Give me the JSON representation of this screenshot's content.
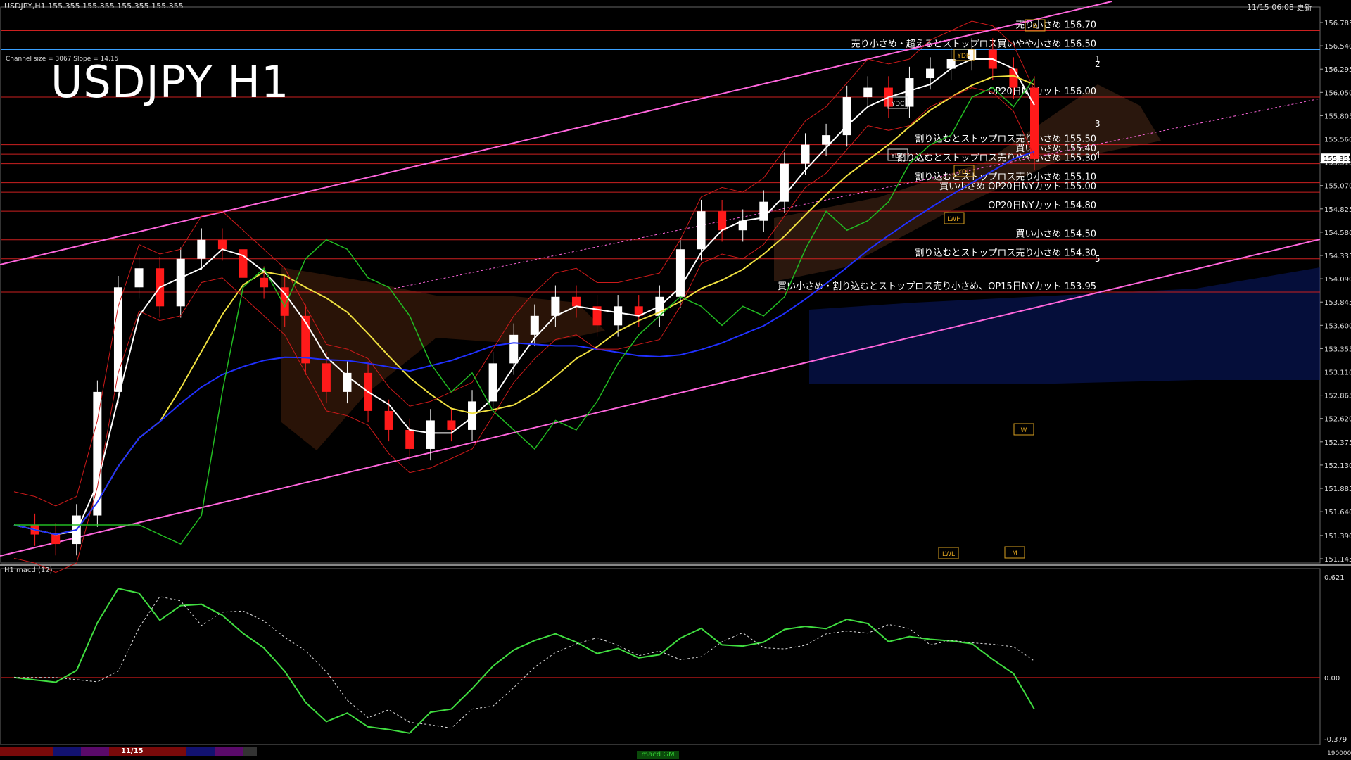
{
  "header": {
    "symbol_line": "USDJPY,H1  155.355 155.355 155.355 155.355",
    "datetime": "11/15 06:08 更新",
    "channel_info": "Channel size = 3067 Slope = 14.15",
    "title": "USDJPY H1",
    "macd_label": "H1  macd (12)"
  },
  "chart_data": {
    "type": "line",
    "title": "USDJPY H1",
    "price_axis": {
      "ticks": [
        "156.785",
        "156.540",
        "156.295",
        "156.050",
        "155.805",
        "155.560",
        "155.315",
        "155.070",
        "154.825",
        "154.580",
        "154.335",
        "154.090",
        "153.845",
        "153.600",
        "153.355",
        "153.110",
        "152.865",
        "152.620",
        "152.375",
        "152.130",
        "151.885",
        "151.640",
        "151.390",
        "151.145"
      ],
      "range": [
        151.145,
        156.785
      ],
      "current_price": "155.355"
    },
    "levels": [
      {
        "price": 156.7,
        "label": "売り小さめ 156.70",
        "color": "#cc2020"
      },
      {
        "price": 156.5,
        "label": "売り小さめ・超えるとストップロス買いやや小さめ 156.50",
        "color": "#3aa0ff"
      },
      {
        "price": 156.0,
        "label": "OP20日NYカット 156.00",
        "color": "#cc2020"
      },
      {
        "price": 155.5,
        "label": "割り込むとストップロス売り小さめ 155.50",
        "color": "#cc2020"
      },
      {
        "price": 155.4,
        "label": "買い小さめ 155.40",
        "color": "#cc2020"
      },
      {
        "price": 155.3,
        "label": "割り込むとストップロス売りやや小さめ 155.30",
        "color": "#cc2020"
      },
      {
        "price": 155.1,
        "label": "割り込むとストップロス売り小さめ 155.10",
        "color": "#cc2020"
      },
      {
        "price": 155.0,
        "label": "買い小さめ OP20日NYカット 155.00",
        "color": "#cc2020"
      },
      {
        "price": 154.8,
        "label": "OP20日NYカット 154.80",
        "color": "#cc2020"
      },
      {
        "price": 154.5,
        "label": "買い小さめ 154.50",
        "color": "#cc2020"
      },
      {
        "price": 154.3,
        "label": "割り込むとストップロス売り小さめ 154.30",
        "color": "#cc2020"
      },
      {
        "price": 153.95,
        "label": "買い小さめ・割り込むとストップロス売り小さめ、OP15日NYカット 153.95",
        "color": "#cc2020"
      }
    ],
    "scenario_labels": [
      "1",
      "2",
      "3",
      "4",
      "5"
    ],
    "markers": [
      "YDC",
      "YDH",
      "YDO",
      "YDL",
      "LWL",
      "LWH",
      "W",
      "D",
      "M"
    ],
    "close_prices": [
      151.5,
      151.4,
      151.3,
      151.6,
      152.9,
      154.0,
      154.2,
      153.8,
      154.3,
      154.5,
      154.4,
      154.1,
      154.0,
      153.7,
      153.2,
      152.9,
      153.1,
      152.7,
      152.5,
      152.3,
      152.6,
      152.5,
      152.8,
      153.2,
      153.5,
      153.7,
      153.9,
      153.8,
      153.6,
      153.8,
      153.7,
      153.9,
      154.4,
      154.8,
      154.6,
      154.7,
      154.9,
      155.3,
      155.5,
      155.6,
      156.0,
      156.1,
      155.9,
      156.2,
      156.3,
      156.4,
      156.5,
      156.3,
      156.1,
      155.35
    ],
    "macd_axis": {
      "ticks": [
        "0.621",
        "0.00",
        "-0.379"
      ],
      "range": [
        -0.379,
        0.621
      ]
    },
    "bottom_timeline": {
      "date_label": "11/15",
      "indicator_label": "macd GM"
    }
  }
}
